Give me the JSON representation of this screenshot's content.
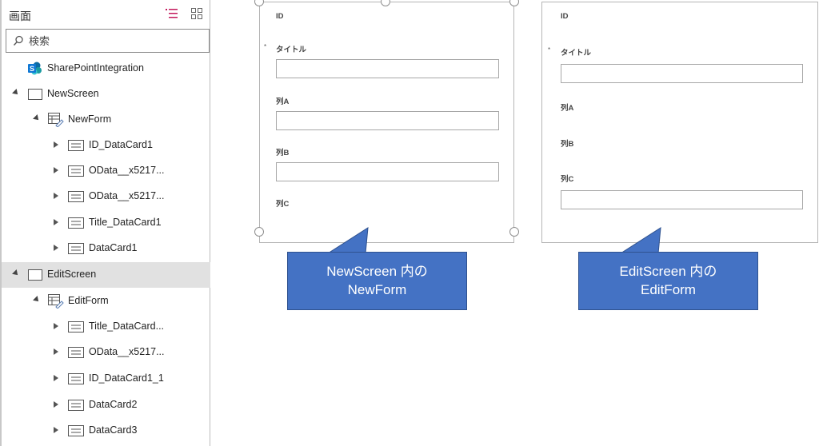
{
  "tree": {
    "title": "画面",
    "search_placeholder": "検索",
    "nodes": [
      {
        "label": "SharePointIntegration"
      },
      {
        "label": "NewScreen"
      },
      {
        "label": "NewForm"
      },
      {
        "label": "ID_DataCard1"
      },
      {
        "label": "OData__x5217..."
      },
      {
        "label": "OData__x5217..."
      },
      {
        "label": "Title_DataCard1"
      },
      {
        "label": "DataCard1"
      },
      {
        "label": "EditScreen"
      },
      {
        "label": "EditForm"
      },
      {
        "label": "Title_DataCard..."
      },
      {
        "label": "OData__x5217..."
      },
      {
        "label": "ID_DataCard1_1"
      },
      {
        "label": "DataCard2"
      },
      {
        "label": "DataCard3"
      }
    ]
  },
  "new_form": {
    "id_label": "ID",
    "title_label": "タイトル",
    "required_marker": "*",
    "colA_label": "列A",
    "colB_label": "列B",
    "colC_label": "列C"
  },
  "edit_form": {
    "id_label": "ID",
    "title_label": "タイトル",
    "required_marker": "*",
    "colA_label": "列A",
    "colB_label": "列B",
    "colC_label": "列C"
  },
  "callouts": {
    "new": {
      "line1": "NewScreen 内の",
      "line2": "NewForm"
    },
    "edit": {
      "line1": "EditScreen 内の",
      "line2": "EditForm"
    }
  },
  "colors": {
    "callout": "#4472c4",
    "selected_row": "#e1e1e1",
    "sharepoint_icon": "#0f78d4"
  },
  "icons": {
    "header_list": "list-view-icon",
    "header_grid": "grid-view-icon",
    "search": "search-icon",
    "sharepoint": "sharepoint-icon",
    "screen": "screen-icon",
    "form": "form-icon",
    "datacard": "datacard-icon"
  }
}
